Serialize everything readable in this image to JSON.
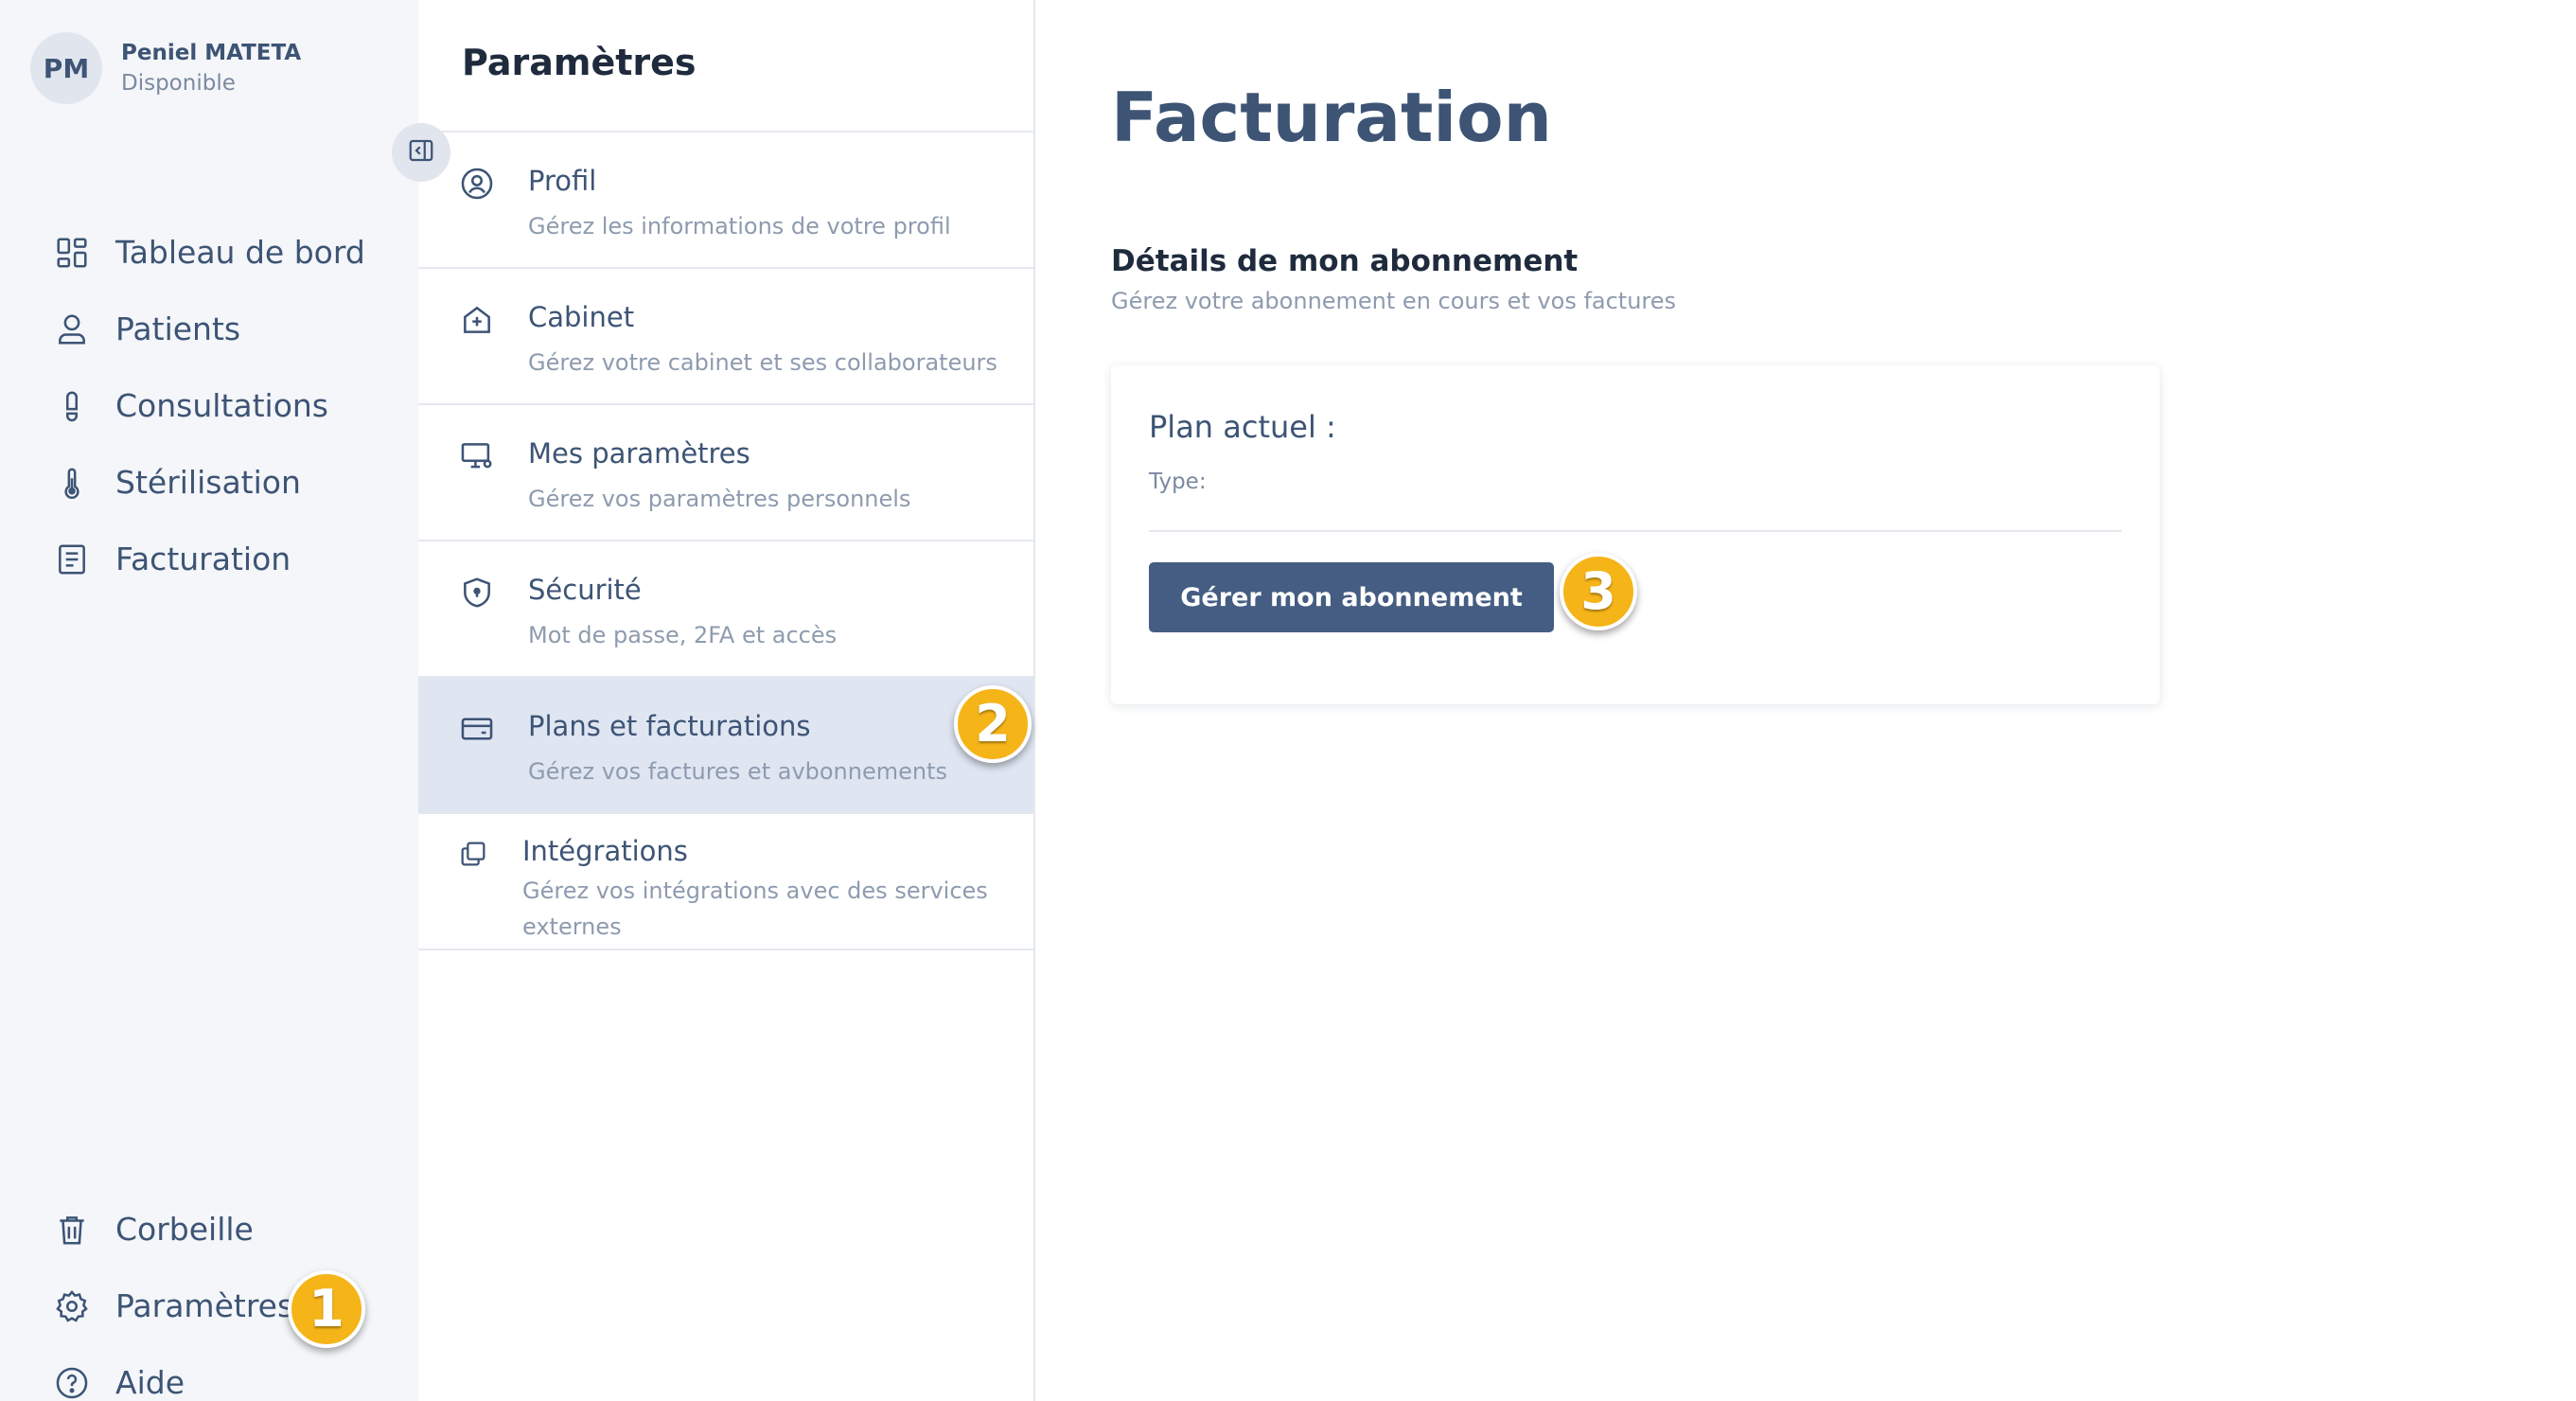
{
  "user": {
    "initials": "PM",
    "name": "Peniel MATETA",
    "status": "Disponible"
  },
  "nav": {
    "top": [
      {
        "label": "Tableau de bord",
        "icon": "dashboard-icon"
      },
      {
        "label": "Patients",
        "icon": "user-icon"
      },
      {
        "label": "Consultations",
        "icon": "footprint-icon"
      },
      {
        "label": "Stérilisation",
        "icon": "thermometer-icon"
      },
      {
        "label": "Facturation",
        "icon": "invoice-icon"
      }
    ],
    "bottom": [
      {
        "label": "Corbeille",
        "icon": "trash-icon"
      },
      {
        "label": "Paramètres",
        "icon": "gear-icon"
      },
      {
        "label": "Aide",
        "icon": "help-icon"
      }
    ]
  },
  "settings": {
    "title": "Paramètres",
    "items": [
      {
        "title": "Profil",
        "desc": "Gérez les informations de votre profil",
        "icon": "user-circle-icon"
      },
      {
        "title": "Cabinet",
        "desc": "Gérez votre cabinet et ses collaborateurs",
        "icon": "house-plus-icon"
      },
      {
        "title": "Mes paramètres",
        "desc": "Gérez vos paramètres personnels",
        "icon": "monitor-gear-icon"
      },
      {
        "title": "Sécurité",
        "desc": "Mot de passe, 2FA et accès",
        "icon": "shield-icon"
      },
      {
        "title": "Plans et facturations",
        "desc": "Gérez vos factures et avbonnements",
        "icon": "credit-card-icon"
      },
      {
        "title": "Intégrations",
        "desc": "Gérez vos intégrations avec des services externes",
        "icon": "copy-icon"
      }
    ]
  },
  "main": {
    "title": "Facturation",
    "section_title": "Détails de mon abonnement",
    "section_sub": "Gérez votre abonnement en cours et vos factures",
    "plan_label": "Plan actuel :",
    "type_label": "Type:",
    "manage_button": "Gérer mon abonnement"
  },
  "badges": {
    "step1": "1",
    "step2": "2",
    "step3": "3"
  },
  "colors": {
    "primary": "#455d82",
    "text": "#3d5475",
    "active_bg": "#dfe6f2",
    "badge": "#f5b418",
    "sidebar_bg": "#f4f6f9"
  }
}
